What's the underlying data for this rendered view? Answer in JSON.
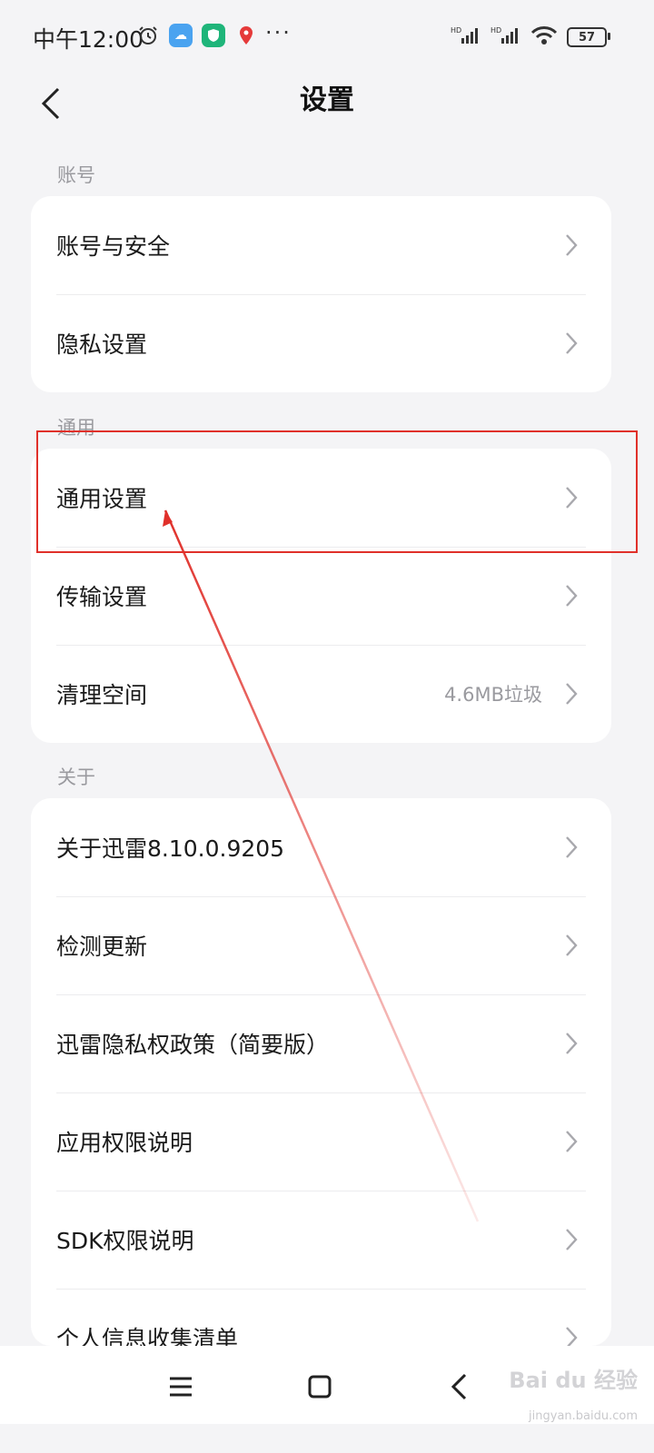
{
  "status_bar": {
    "time": "中午12:00",
    "battery": "57",
    "icons": [
      "alarm-icon",
      "weather-icon",
      "security-icon",
      "map-icon"
    ],
    "more": "···"
  },
  "header": {
    "title": "设置"
  },
  "sections": [
    {
      "label": "账号",
      "items": [
        {
          "label": "账号与安全",
          "value": ""
        },
        {
          "label": "隐私设置",
          "value": ""
        }
      ]
    },
    {
      "label": "通用",
      "items": [
        {
          "label": "通用设置",
          "value": ""
        },
        {
          "label": "传输设置",
          "value": ""
        },
        {
          "label": "清理空间",
          "value": "4.6MB垃圾"
        }
      ]
    },
    {
      "label": "关于",
      "items": [
        {
          "label": "关于迅雷8.10.0.9205",
          "value": ""
        },
        {
          "label": "检测更新",
          "value": ""
        },
        {
          "label": "迅雷隐私权政策（简要版）",
          "value": ""
        },
        {
          "label": "应用权限说明",
          "value": ""
        },
        {
          "label": "SDK权限说明",
          "value": ""
        },
        {
          "label": "个人信息收集清单",
          "value": ""
        }
      ]
    }
  ],
  "watermark": {
    "main": "Bai du 经验",
    "sub": "jingyan.baidu.com"
  },
  "colors": {
    "annotation": "#e0302a",
    "background": "#f4f4f6"
  }
}
